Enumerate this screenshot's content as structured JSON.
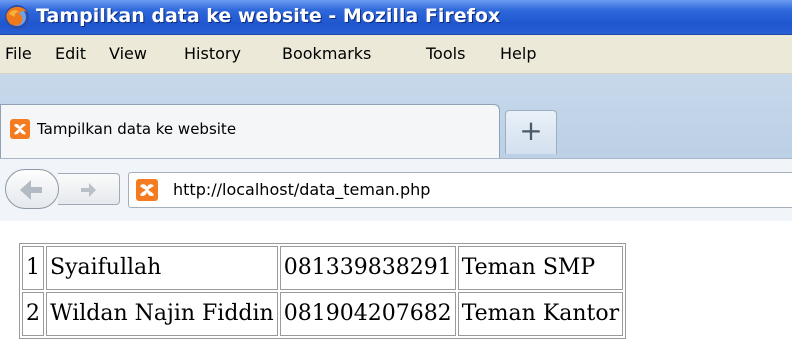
{
  "window": {
    "title": "Tampilkan data ke website - Mozilla Firefox"
  },
  "menu": {
    "file": "File",
    "edit": "Edit",
    "view": "View",
    "history": "History",
    "bookmarks": "Bookmarks",
    "tools": "Tools",
    "help": "Help"
  },
  "tabs": {
    "active_label": "Tampilkan data ke website",
    "new_tab_glyph": "+"
  },
  "navigation": {
    "url": "http://localhost/data_teman.php"
  },
  "table": {
    "rows": [
      {
        "no": "1",
        "name": "Syaifullah",
        "phone": "081339838291",
        "category": "Teman SMP"
      },
      {
        "no": "2",
        "name": "Wildan Najin Fiddin",
        "phone": "081904207682",
        "category": "Teman Kantor"
      }
    ]
  },
  "colors": {
    "titlebar": "#2e68db",
    "menubar": "#ece9d8",
    "tabstrip": "#c7d8ea",
    "xampp_orange": "#f47b20"
  },
  "icons": {
    "firefox": "firefox-icon",
    "favicon": "xampp-icon",
    "back": "back-arrow-icon",
    "forward": "forward-arrow-icon",
    "site_identity": "xampp-icon"
  }
}
